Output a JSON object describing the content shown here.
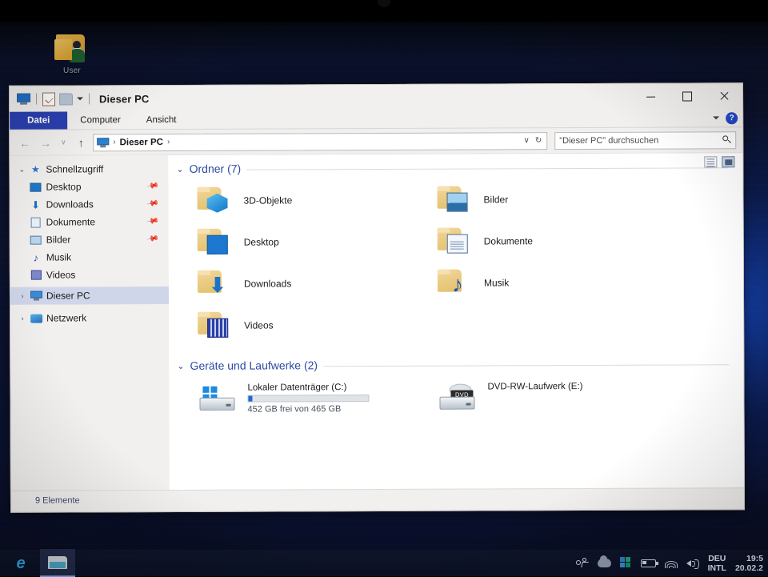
{
  "desktop": {
    "icon": {
      "label": "User",
      "icon": "user-folder-icon"
    }
  },
  "window": {
    "title": "Dieser PC",
    "quick_access": [
      {
        "name": "this-pc-icon"
      },
      {
        "name": "properties-icon"
      },
      {
        "name": "new-folder-icon"
      },
      {
        "name": "customize-dropdown-icon"
      }
    ],
    "controls": {
      "minimize": "minimize-button",
      "maximize": "maximize-button",
      "close": "close-button",
      "ribbon_collapse": "ribbon-collapse-chevron",
      "help": "?"
    },
    "tabs": [
      {
        "label": "Datei",
        "active": true
      },
      {
        "label": "Computer",
        "active": false
      },
      {
        "label": "Ansicht",
        "active": false
      }
    ],
    "address": {
      "back": "←",
      "forward": "→",
      "recent": "∨",
      "up": "↑",
      "crumbs": [
        "Dieser PC"
      ],
      "crumb_separator": "›",
      "dropdown": "∨",
      "refresh": "↻"
    },
    "search": {
      "placeholder": "\"Dieser PC\" durchsuchen"
    },
    "statusbar": {
      "items_text": "9 Elemente",
      "view_details": "details-view-button",
      "view_tiles": "large-icons-view-button"
    }
  },
  "sidebar": {
    "items": [
      {
        "label": "Schnellzugriff",
        "icon": "star-icon",
        "twisty": "⌄",
        "pinned": false,
        "selected": false,
        "indent": 0
      },
      {
        "label": "Desktop",
        "icon": "desktop-icon",
        "twisty": "",
        "pinned": true,
        "selected": false,
        "indent": 1
      },
      {
        "label": "Downloads",
        "icon": "downloads-icon",
        "twisty": "",
        "pinned": true,
        "selected": false,
        "indent": 1
      },
      {
        "label": "Dokumente",
        "icon": "documents-icon",
        "twisty": "",
        "pinned": true,
        "selected": false,
        "indent": 1
      },
      {
        "label": "Bilder",
        "icon": "pictures-icon",
        "twisty": "",
        "pinned": true,
        "selected": false,
        "indent": 1
      },
      {
        "label": "Musik",
        "icon": "music-icon",
        "twisty": "",
        "pinned": false,
        "selected": false,
        "indent": 1
      },
      {
        "label": "Videos",
        "icon": "videos-icon",
        "twisty": "",
        "pinned": false,
        "selected": false,
        "indent": 1
      },
      {
        "label": "Dieser PC",
        "icon": "this-pc-icon",
        "twisty": "›",
        "pinned": false,
        "selected": true,
        "indent": 0
      },
      {
        "label": "Netzwerk",
        "icon": "network-icon",
        "twisty": "›",
        "pinned": false,
        "selected": false,
        "indent": 0
      }
    ]
  },
  "content": {
    "groups": [
      {
        "header": "Ordner (7)",
        "chevron": "⌄",
        "items": [
          {
            "name": "3D-Objekte",
            "icon": "folder-3d-objects-icon"
          },
          {
            "name": "Bilder",
            "icon": "folder-pictures-icon"
          },
          {
            "name": "Desktop",
            "icon": "folder-desktop-icon"
          },
          {
            "name": "Dokumente",
            "icon": "folder-documents-icon"
          },
          {
            "name": "Downloads",
            "icon": "folder-downloads-icon"
          },
          {
            "name": "Musik",
            "icon": "folder-music-icon"
          },
          {
            "name": "Videos",
            "icon": "folder-videos-icon"
          }
        ]
      },
      {
        "header": "Geräte und Laufwerke (2)",
        "chevron": "⌄",
        "drives": [
          {
            "name": "Lokaler Datenträger (C:)",
            "icon": "windows-hard-drive-icon",
            "free_text": "452 GB frei von 465 GB",
            "used_percent": 3,
            "bar_color": "#2168cf"
          },
          {
            "name": "DVD-RW-Laufwerk (E:)",
            "icon": "dvd-drive-icon",
            "badge": "DVD",
            "free_text": "",
            "used_percent": 0
          }
        ]
      }
    ]
  },
  "taskbar": {
    "apps": [
      {
        "name": "edge-icon",
        "glyph": "e",
        "active": false
      },
      {
        "name": "file-explorer-icon",
        "glyph": "",
        "active": true
      }
    ],
    "tray": [
      {
        "name": "people-icon"
      },
      {
        "name": "onedrive-cloud-icon"
      },
      {
        "name": "security-icon"
      },
      {
        "name": "battery-icon"
      },
      {
        "name": "wifi-icon"
      },
      {
        "name": "volume-icon"
      }
    ],
    "keyboard": {
      "line1": "DEU",
      "line2": "INTL"
    },
    "clock": {
      "time": "19:5",
      "date": "20.02.2"
    }
  },
  "colors": {
    "accent": "#2a3fb0",
    "selection": "#cfd6ea",
    "group_header": "#2b4aa0",
    "drive_bar": "#2168cf"
  }
}
